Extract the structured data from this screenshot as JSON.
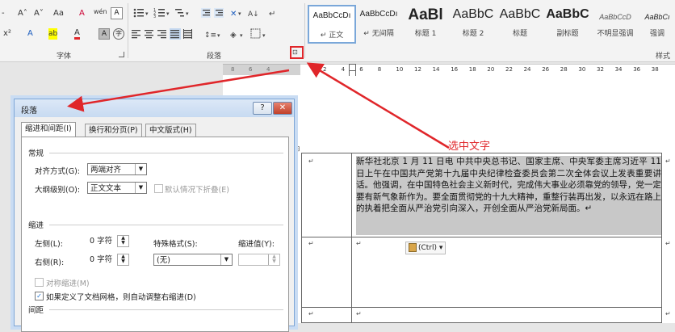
{
  "ribbon": {
    "font_group": {
      "label": "字体",
      "row1": [
        "-",
        "A˄",
        "A˅",
        "Aa",
        "A",
        "wén",
        "A"
      ],
      "row2": [
        "x²",
        "A",
        "ab",
        "A",
        "A",
        "字"
      ]
    },
    "paragraph_group": {
      "label": "段落",
      "launcher": "⊡"
    },
    "styles_group": {
      "label": "样式",
      "items": [
        {
          "sample": "AaBbCcDı",
          "name": "↵ 正文",
          "selected": true
        },
        {
          "sample": "AaBbCcDı",
          "name": "↵ 无间隔"
        },
        {
          "sample": "AaBl",
          "name": "标题 1"
        },
        {
          "sample": "AaBbC",
          "name": "标题 2"
        },
        {
          "sample": "AaBbC",
          "name": "标题"
        },
        {
          "sample": "AaBbC",
          "name": "副标题"
        },
        {
          "sample": "AaBbCcD",
          "name": "不明显强调"
        },
        {
          "sample": "AaBbCı",
          "name": "强调"
        }
      ]
    }
  },
  "ruler": {
    "left_numbers": [
      "8",
      "6",
      "4"
    ],
    "right_numbers": [
      "2",
      "4",
      "6",
      "8",
      "10",
      "12",
      "14",
      "16",
      "18",
      "20",
      "22",
      "24",
      "26",
      "28",
      "30",
      "32",
      "34",
      "36",
      "38"
    ]
  },
  "dialog": {
    "title": "段落",
    "help_btn": "?",
    "close_btn": "✕",
    "tabs": [
      "缩进和间距(I)",
      "换行和分页(P)",
      "中文版式(H)"
    ],
    "general": {
      "heading": "常规",
      "alignment_label": "对齐方式(G):",
      "alignment_value": "两端对齐",
      "outline_label": "大纲级别(O):",
      "outline_value": "正文文本",
      "collapse_label": "默认情况下折叠(E)"
    },
    "indent": {
      "heading": "缩进",
      "left_label": "左侧(L):",
      "left_value": "0 字符",
      "right_label": "右侧(R):",
      "right_value": "0 字符",
      "special_label": "特殊格式(S):",
      "special_value": "(无)",
      "indent_value_label": "缩进值(Y):",
      "mirror_label": "对称缩进(M)",
      "auto_adjust_label": "如果定义了文档网格，则自动调整右缩进(D)"
    },
    "spacing": {
      "heading": "间距"
    }
  },
  "document": {
    "paragraph": "新华社北京 1 月 11 日电   中共中央总书记、国家主席、中央军委主席习近平 11 日上午在中国共产党第十九届中央纪律检查委员会第二次全体会议上发表重要讲话。他强调，在中国特色社会主义新时代，完成伟大事业必须靠党的领导，党一定要有新气象新作为。要全面贯彻党的十九大精神，重整行装再出发，以永远在路上的执着把全面从严治党引向深入，开创全面从严治党新局面。↵",
    "paste_options": "(Ctrl) ▾",
    "cell_mark": "↵",
    "move_handle": "⊞"
  },
  "annotation": {
    "text": "选中文字",
    "color": "#e0262a"
  }
}
